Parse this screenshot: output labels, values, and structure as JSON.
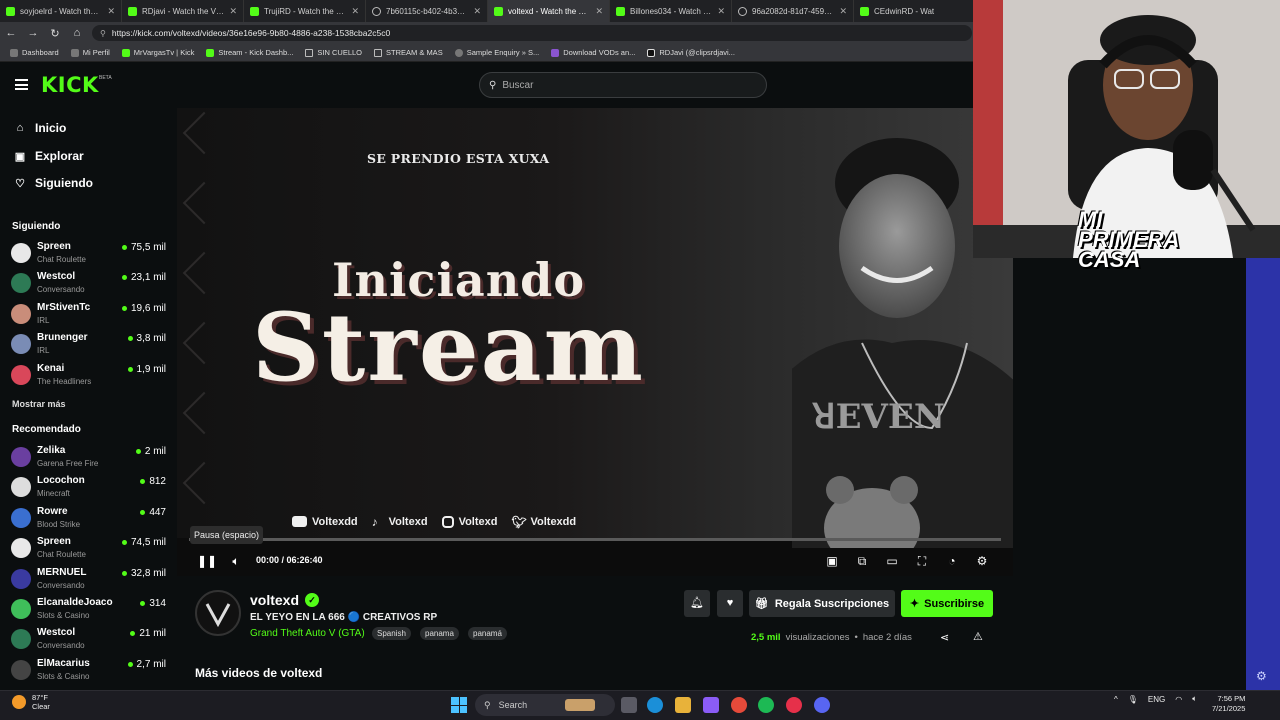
{
  "browser": {
    "tabs": [
      {
        "label": "soyjoelrd - Watch the VOD",
        "icon": "kick"
      },
      {
        "label": "RDjavi - Watch the VOD on",
        "icon": "kick"
      },
      {
        "label": "TrujiRD - Watch the VOD",
        "icon": "kick"
      },
      {
        "label": "7b60115c-b402-4b39-b3",
        "icon": "globe"
      },
      {
        "label": "voltexd - Watch the VOD",
        "icon": "kick",
        "active": true
      },
      {
        "label": "Billones034 - Watch the V",
        "icon": "kick"
      },
      {
        "label": "96a2082d-81d7-4591-ae",
        "icon": "globe"
      },
      {
        "label": "CEdwinRD - Wat",
        "icon": "kick"
      }
    ],
    "url": "https://kick.com/voltexd/videos/36e16e96-9b80-4886-a238-1538cba2c5c0",
    "bookmarks": [
      {
        "label": "Dashboard",
        "icon": "app"
      },
      {
        "label": "Mi Perfil",
        "icon": "app"
      },
      {
        "label": "MrVargasTv | Kick",
        "icon": "kick"
      },
      {
        "label": "Stream - Kick Dashb...",
        "icon": "kick"
      },
      {
        "label": "SIN CUELLO",
        "icon": "folder"
      },
      {
        "label": "STREAM & MAS",
        "icon": "folder"
      },
      {
        "label": "Sample Enquiry » S...",
        "icon": "globe"
      },
      {
        "label": "Download VODs an...",
        "icon": "app"
      },
      {
        "label": "RDJavi (@clipsrdjavi...",
        "icon": "tiktok"
      }
    ]
  },
  "header": {
    "logo": "KICK",
    "logo_badge": "BETA",
    "search_placeholder": "Buscar"
  },
  "sidebar": {
    "nav": [
      {
        "label": "Inicio",
        "icon": "home-icon"
      },
      {
        "label": "Explorar",
        "icon": "explore-icon"
      },
      {
        "label": "Siguiendo",
        "icon": "heart-icon"
      }
    ],
    "following_title": "Siguiendo",
    "following": [
      {
        "name": "Spreen",
        "category": "Chat Roulette",
        "viewers": "75,5 mil",
        "color": "#e8e8e8"
      },
      {
        "name": "Westcol",
        "category": "Conversando",
        "viewers": "23,1 mil",
        "color": "#2d7a55"
      },
      {
        "name": "MrStivenTc",
        "category": "IRL",
        "viewers": "19,6 mil",
        "color": "#c98d7a"
      },
      {
        "name": "Brunenger",
        "category": "IRL",
        "viewers": "3,8 mil",
        "color": "#7a8cb5"
      },
      {
        "name": "Kenai",
        "category": "The Headliners",
        "viewers": "1,9 mil",
        "color": "#d9475a"
      }
    ],
    "show_more": "Mostrar más",
    "recommended_title": "Recomendado",
    "recommended": [
      {
        "name": "Zelika",
        "category": "Garena Free Fire",
        "viewers": "2 mil",
        "color": "#6a3fa0"
      },
      {
        "name": "Locochon",
        "category": "Minecraft",
        "viewers": "812",
        "color": "#dddddd"
      },
      {
        "name": "Rowre",
        "category": "Blood Strike",
        "viewers": "447",
        "color": "#3a6fd0"
      },
      {
        "name": "Spreen",
        "category": "Chat Roulette",
        "viewers": "74,5 mil",
        "color": "#e8e8e8"
      },
      {
        "name": "MERNUEL",
        "category": "Conversando",
        "viewers": "32,8 mil",
        "color": "#3a3aa0"
      },
      {
        "name": "ElcanaldeJoaco",
        "category": "Slots & Casino",
        "viewers": "314",
        "color": "#3fbf5a"
      },
      {
        "name": "Westcol",
        "category": "Conversando",
        "viewers": "21 mil",
        "color": "#2d7a55"
      },
      {
        "name": "ElMacarius",
        "category": "Slots & Casino",
        "viewers": "2,7 mil",
        "color": "#444444"
      }
    ]
  },
  "video": {
    "overlay_top": "SE PRENDIO ESTA XUXA",
    "overlay_line1": "Iniciando",
    "overlay_line2": "Stream",
    "socials": [
      {
        "label": "Voltexdd",
        "icon": "youtube"
      },
      {
        "label": "Voltexd",
        "icon": "tiktok"
      },
      {
        "label": "Voltexd",
        "icon": "instagram"
      },
      {
        "label": "Voltexdd",
        "icon": "twitter"
      }
    ],
    "tooltip": "Pausa (espacio)",
    "time": "00:00 / 06:26:40",
    "progress": 0
  },
  "webcam": {
    "title": "MI PRIMERA CASA"
  },
  "info": {
    "channel": "voltexd",
    "stream_title": "EL YEYO EN LA 666 🔵 CREATIVOS RP",
    "game": "Grand Theft Auto V (GTA)",
    "tags": [
      "Spanish",
      "panama",
      "panamá"
    ],
    "gifts_label": "Regala Suscripciones",
    "subscribe_label": "Suscribirse",
    "views": "2,5 mil",
    "views_suffix": "visualizaciones",
    "dot": "•",
    "ago": "hace 2 días",
    "more_videos": "Más videos de voltexd"
  },
  "taskbar": {
    "temp": "87°F",
    "weather": "Clear",
    "search": "Search",
    "lang": "ENG",
    "time": "7:56 PM",
    "date": "7/21/2025"
  },
  "colors": {
    "accent": "#53fc18",
    "background": "#0b0e0f",
    "panel": "#2a2d2f"
  }
}
